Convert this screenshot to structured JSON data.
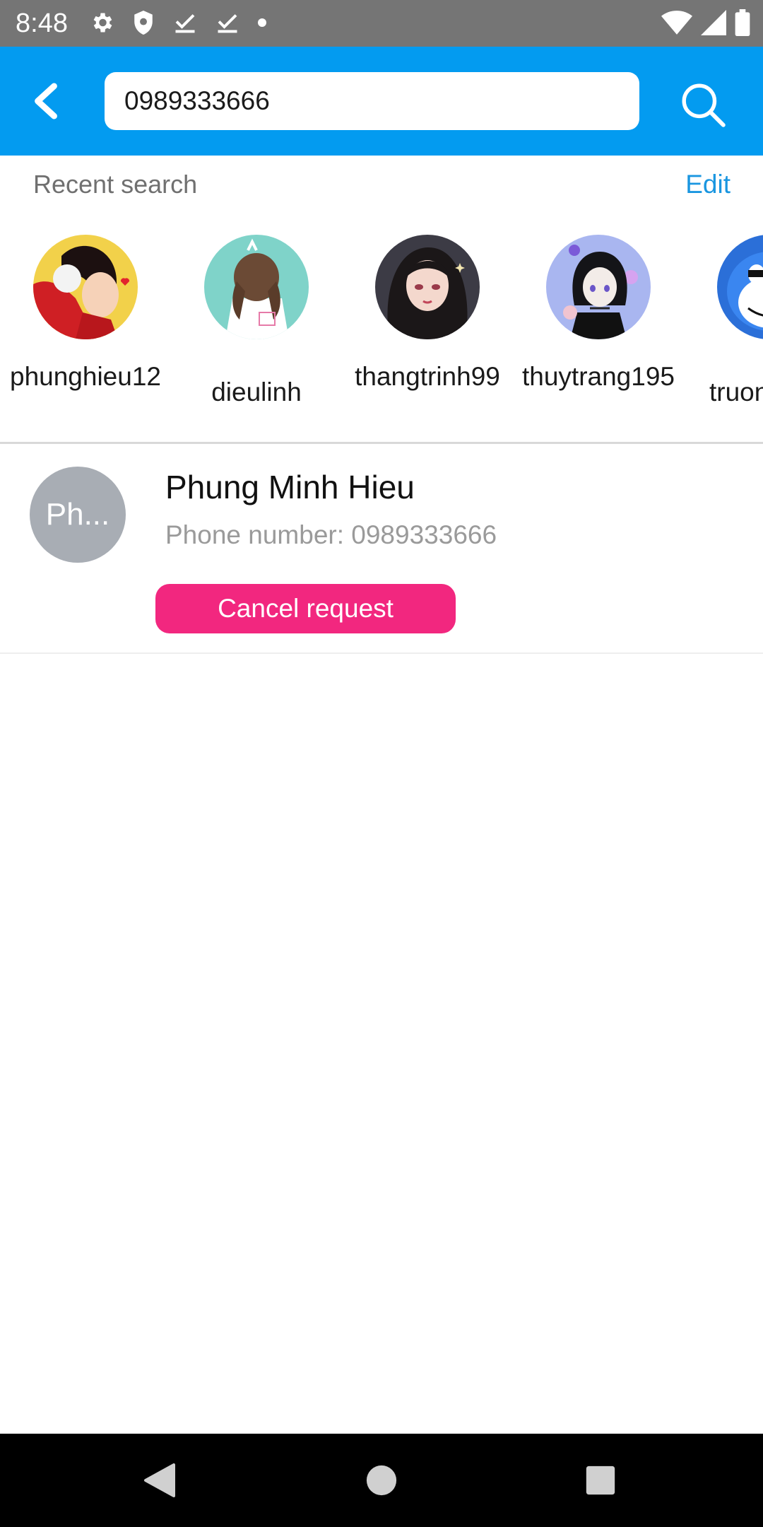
{
  "status_bar": {
    "time": "8:48",
    "icons_left": [
      "settings-icon",
      "shield-icon",
      "download-done-icon",
      "download-done-icon",
      "dot-icon"
    ],
    "icons_right": [
      "wifi-icon",
      "cell-signal-icon",
      "battery-icon"
    ]
  },
  "header": {
    "search_value": "0989333666",
    "back_icon": "chevron-left-icon",
    "search_icon": "search-icon",
    "background_color": "#039BF0"
  },
  "recent": {
    "title": "Recent search",
    "edit_label": "Edit",
    "items": [
      {
        "username": "phunghieu12",
        "avatar": "red-hoodie-boy-avatar"
      },
      {
        "username": "dieulinh",
        "avatar": "girl-pigtails-avatar"
      },
      {
        "username": "thangtrinh99",
        "avatar": "dark-hair-girl-avatar"
      },
      {
        "username": "thuytrang195",
        "avatar": "black-hair-girl-avatar"
      },
      {
        "username": "truon",
        "avatar": "blue-robot-cat-avatar"
      }
    ]
  },
  "result": {
    "avatar_text": "Ph...",
    "name": "Phung Minh Hieu",
    "phone": "Phone number: 0989333666",
    "action_label": "Cancel request",
    "action_color": "#F2277F"
  },
  "nav_bar": {
    "buttons": [
      "back-triangle-icon",
      "home-circle-icon",
      "recents-square-icon"
    ]
  }
}
